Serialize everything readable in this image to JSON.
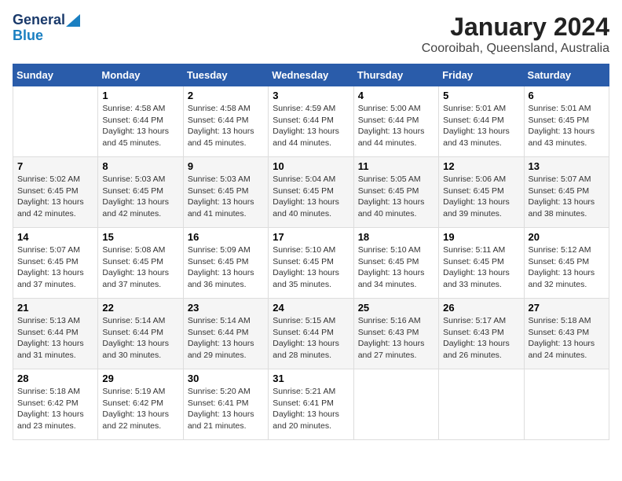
{
  "header": {
    "logo_line1": "General",
    "logo_line2": "Blue",
    "title": "January 2024",
    "subtitle": "Cooroibah, Queensland, Australia"
  },
  "days_of_week": [
    "Sunday",
    "Monday",
    "Tuesday",
    "Wednesday",
    "Thursday",
    "Friday",
    "Saturday"
  ],
  "weeks": [
    [
      {
        "day": "",
        "info": ""
      },
      {
        "day": "1",
        "info": "Sunrise: 4:58 AM\nSunset: 6:44 PM\nDaylight: 13 hours\nand 45 minutes."
      },
      {
        "day": "2",
        "info": "Sunrise: 4:58 AM\nSunset: 6:44 PM\nDaylight: 13 hours\nand 45 minutes."
      },
      {
        "day": "3",
        "info": "Sunrise: 4:59 AM\nSunset: 6:44 PM\nDaylight: 13 hours\nand 44 minutes."
      },
      {
        "day": "4",
        "info": "Sunrise: 5:00 AM\nSunset: 6:44 PM\nDaylight: 13 hours\nand 44 minutes."
      },
      {
        "day": "5",
        "info": "Sunrise: 5:01 AM\nSunset: 6:44 PM\nDaylight: 13 hours\nand 43 minutes."
      },
      {
        "day": "6",
        "info": "Sunrise: 5:01 AM\nSunset: 6:45 PM\nDaylight: 13 hours\nand 43 minutes."
      }
    ],
    [
      {
        "day": "7",
        "info": "Sunrise: 5:02 AM\nSunset: 6:45 PM\nDaylight: 13 hours\nand 42 minutes."
      },
      {
        "day": "8",
        "info": "Sunrise: 5:03 AM\nSunset: 6:45 PM\nDaylight: 13 hours\nand 42 minutes."
      },
      {
        "day": "9",
        "info": "Sunrise: 5:03 AM\nSunset: 6:45 PM\nDaylight: 13 hours\nand 41 minutes."
      },
      {
        "day": "10",
        "info": "Sunrise: 5:04 AM\nSunset: 6:45 PM\nDaylight: 13 hours\nand 40 minutes."
      },
      {
        "day": "11",
        "info": "Sunrise: 5:05 AM\nSunset: 6:45 PM\nDaylight: 13 hours\nand 40 minutes."
      },
      {
        "day": "12",
        "info": "Sunrise: 5:06 AM\nSunset: 6:45 PM\nDaylight: 13 hours\nand 39 minutes."
      },
      {
        "day": "13",
        "info": "Sunrise: 5:07 AM\nSunset: 6:45 PM\nDaylight: 13 hours\nand 38 minutes."
      }
    ],
    [
      {
        "day": "14",
        "info": "Sunrise: 5:07 AM\nSunset: 6:45 PM\nDaylight: 13 hours\nand 37 minutes."
      },
      {
        "day": "15",
        "info": "Sunrise: 5:08 AM\nSunset: 6:45 PM\nDaylight: 13 hours\nand 37 minutes."
      },
      {
        "day": "16",
        "info": "Sunrise: 5:09 AM\nSunset: 6:45 PM\nDaylight: 13 hours\nand 36 minutes."
      },
      {
        "day": "17",
        "info": "Sunrise: 5:10 AM\nSunset: 6:45 PM\nDaylight: 13 hours\nand 35 minutes."
      },
      {
        "day": "18",
        "info": "Sunrise: 5:10 AM\nSunset: 6:45 PM\nDaylight: 13 hours\nand 34 minutes."
      },
      {
        "day": "19",
        "info": "Sunrise: 5:11 AM\nSunset: 6:45 PM\nDaylight: 13 hours\nand 33 minutes."
      },
      {
        "day": "20",
        "info": "Sunrise: 5:12 AM\nSunset: 6:45 PM\nDaylight: 13 hours\nand 32 minutes."
      }
    ],
    [
      {
        "day": "21",
        "info": "Sunrise: 5:13 AM\nSunset: 6:44 PM\nDaylight: 13 hours\nand 31 minutes."
      },
      {
        "day": "22",
        "info": "Sunrise: 5:14 AM\nSunset: 6:44 PM\nDaylight: 13 hours\nand 30 minutes."
      },
      {
        "day": "23",
        "info": "Sunrise: 5:14 AM\nSunset: 6:44 PM\nDaylight: 13 hours\nand 29 minutes."
      },
      {
        "day": "24",
        "info": "Sunrise: 5:15 AM\nSunset: 6:44 PM\nDaylight: 13 hours\nand 28 minutes."
      },
      {
        "day": "25",
        "info": "Sunrise: 5:16 AM\nSunset: 6:43 PM\nDaylight: 13 hours\nand 27 minutes."
      },
      {
        "day": "26",
        "info": "Sunrise: 5:17 AM\nSunset: 6:43 PM\nDaylight: 13 hours\nand 26 minutes."
      },
      {
        "day": "27",
        "info": "Sunrise: 5:18 AM\nSunset: 6:43 PM\nDaylight: 13 hours\nand 24 minutes."
      }
    ],
    [
      {
        "day": "28",
        "info": "Sunrise: 5:18 AM\nSunset: 6:42 PM\nDaylight: 13 hours\nand 23 minutes."
      },
      {
        "day": "29",
        "info": "Sunrise: 5:19 AM\nSunset: 6:42 PM\nDaylight: 13 hours\nand 22 minutes."
      },
      {
        "day": "30",
        "info": "Sunrise: 5:20 AM\nSunset: 6:41 PM\nDaylight: 13 hours\nand 21 minutes."
      },
      {
        "day": "31",
        "info": "Sunrise: 5:21 AM\nSunset: 6:41 PM\nDaylight: 13 hours\nand 20 minutes."
      },
      {
        "day": "",
        "info": ""
      },
      {
        "day": "",
        "info": ""
      },
      {
        "day": "",
        "info": ""
      }
    ]
  ]
}
